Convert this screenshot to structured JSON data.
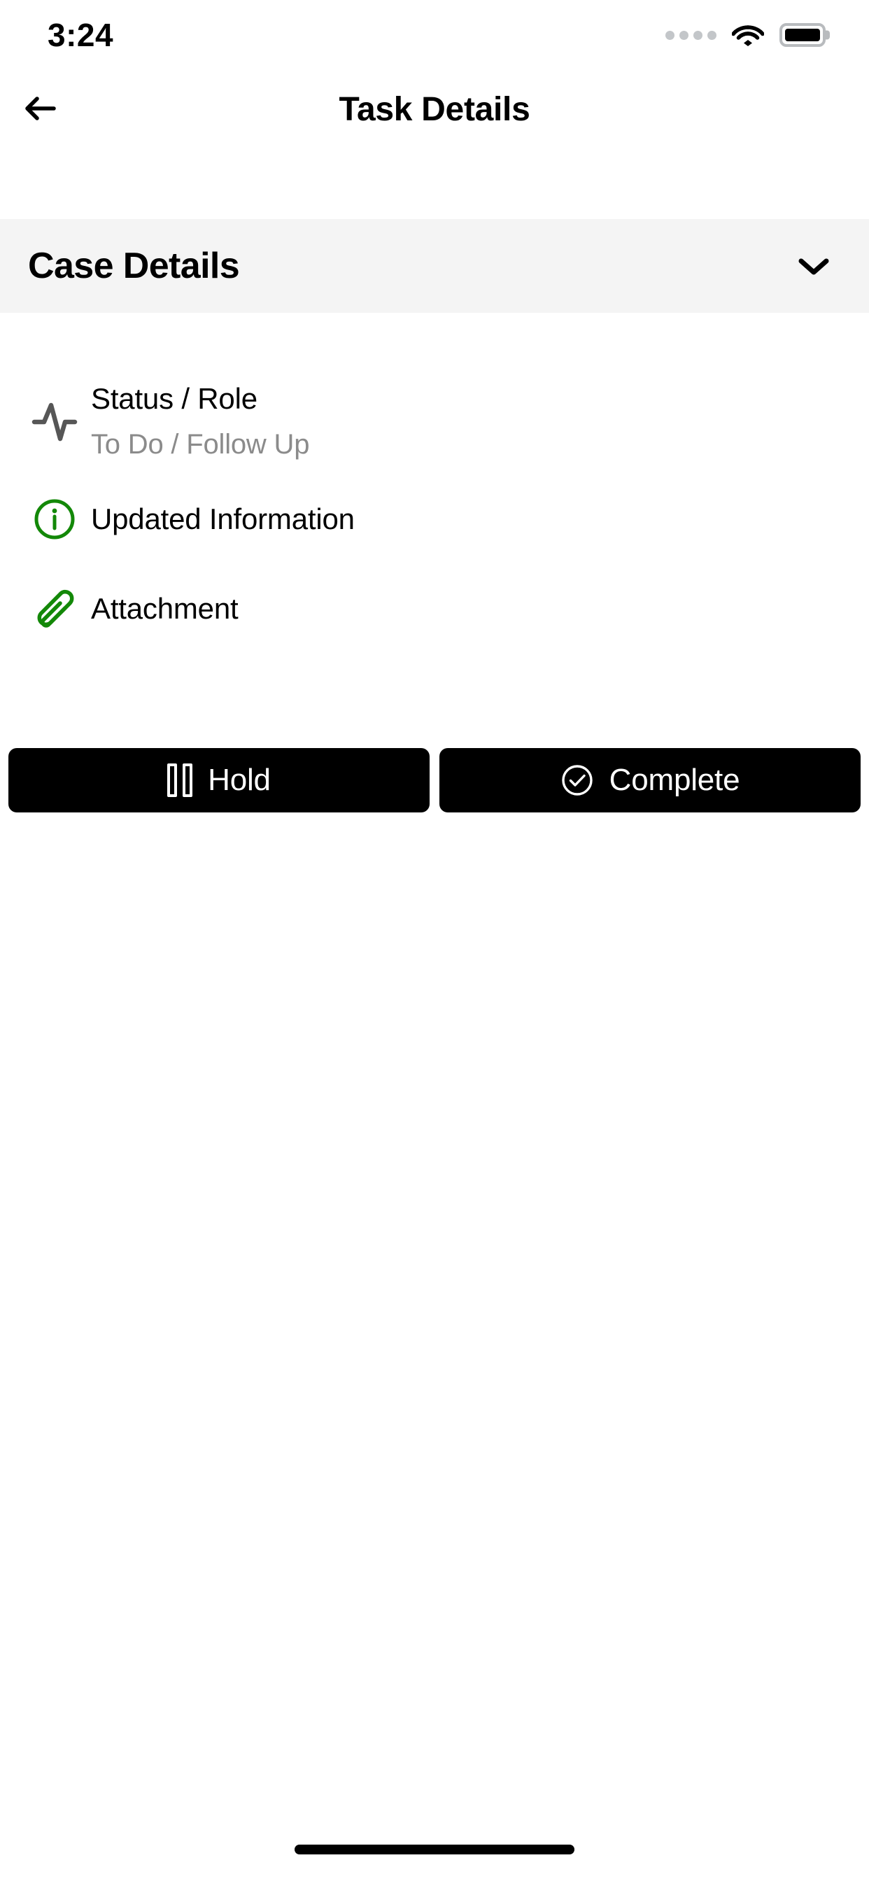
{
  "status_bar": {
    "time": "3:24",
    "signal_icon": "signal-dots-icon",
    "wifi_icon": "wifi-icon",
    "battery_icon": "battery-full-icon"
  },
  "nav": {
    "back_icon": "arrow-left-icon",
    "title": "Task Details"
  },
  "section": {
    "title": "Case Details",
    "expanded": true,
    "toggle_icon": "chevron-down-icon"
  },
  "details": {
    "status_role": {
      "icon": "activity-pulse-icon",
      "label": "Status / Role",
      "value": "To Do / Follow Up"
    },
    "updated_information": {
      "icon": "info-circle-icon",
      "label": "Updated Information"
    },
    "attachment": {
      "icon": "paperclip-icon",
      "label": "Attachment"
    }
  },
  "actions": {
    "hold": {
      "label": "Hold",
      "icon": "pause-icon"
    },
    "complete": {
      "label": "Complete",
      "icon": "check-circle-icon"
    }
  },
  "colors": {
    "accent_green": "#138808",
    "section_bg": "#f4f4f4",
    "button_bg": "#000000",
    "muted_text": "#8b8b8b"
  }
}
